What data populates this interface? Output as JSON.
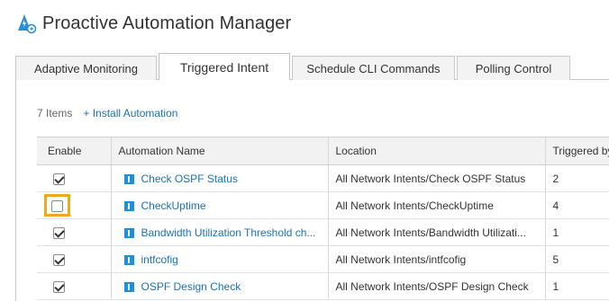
{
  "app": {
    "title": "Proactive Automation Manager",
    "icon": "automation-gear-icon"
  },
  "tabs": [
    {
      "label": "Adaptive Monitoring",
      "active": false
    },
    {
      "label": "Triggered Intent",
      "active": true
    },
    {
      "label": "Schedule CLI Commands",
      "active": false
    },
    {
      "label": "Polling Control",
      "active": false
    }
  ],
  "toolbar": {
    "count": "7 Items",
    "install_label": "+ Install Automation"
  },
  "table": {
    "headers": {
      "enable": "Enable",
      "name": "Automation Name",
      "location": "Location",
      "triggered": "Triggered by"
    },
    "rows": [
      {
        "enabled": true,
        "name": "Check OSPF Status",
        "location": "All Network Intents/Check OSPF Status",
        "triggered": "2"
      },
      {
        "enabled": false,
        "name": "CheckUptime",
        "location": "All Network Intents/CheckUptime",
        "triggered": "4"
      },
      {
        "enabled": true,
        "name": "Bandwidth Utilization Threshold ch...",
        "location": "All Network Intents/Bandwidth Utilizati...",
        "triggered": "1"
      },
      {
        "enabled": true,
        "name": "intfcofig",
        "location": "All Network Intents/intfcofig",
        "triggered": "5"
      },
      {
        "enabled": true,
        "name": "OSPF Design Check",
        "location": "All Network Intents/OSPF Design Check",
        "triggered": "1"
      }
    ]
  },
  "colors": {
    "accent": "#1a73b8",
    "highlight": "#f4a522",
    "icon_blue": "#1e90d8"
  }
}
